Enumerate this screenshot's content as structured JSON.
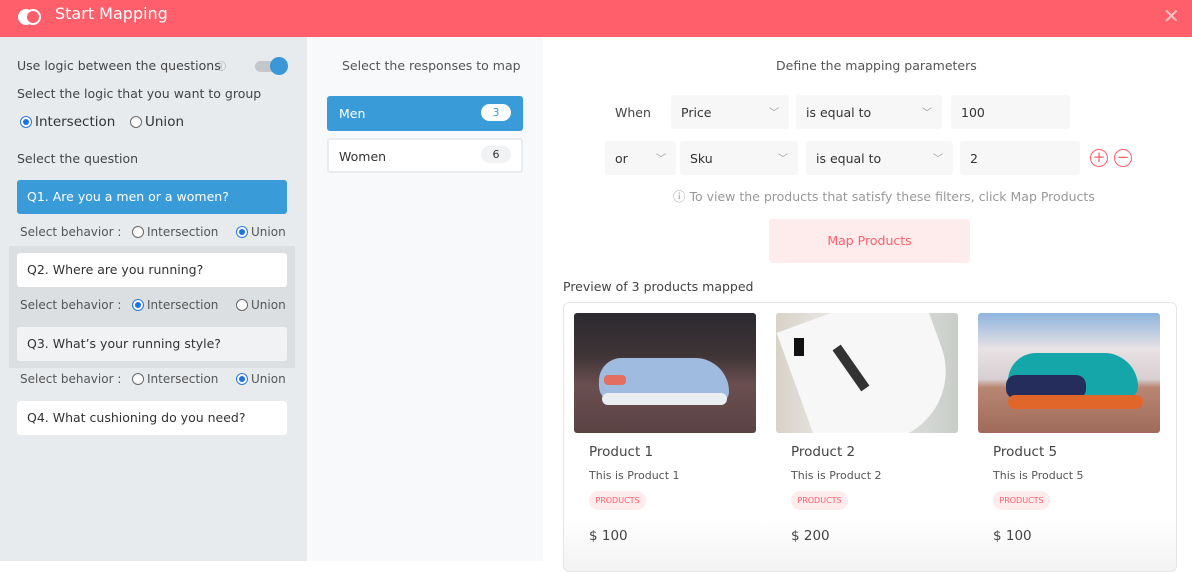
{
  "header": {
    "title": "Start Mapping",
    "logo_icon": "overlapping-circles-icon",
    "close_icon": "close-icon"
  },
  "left": {
    "use_logic_label": "Use logic between the questions",
    "info_icon": "info-icon",
    "toggle_on": true,
    "group_label": "Select the logic that you want to group",
    "group_options": [
      "Intersection",
      "Union"
    ],
    "group_selected": "Intersection",
    "select_question_label": "Select the question",
    "behavior_label": "Select behavior :",
    "behavior_options": [
      "Intersection",
      "Union"
    ],
    "questions": [
      {
        "label": "Q1.  Are you a men or a women?",
        "behavior": "Union"
      },
      {
        "label": "Q2.  Where are you running?",
        "behavior": "Intersection"
      },
      {
        "label": "Q3.  What’s your running style?",
        "behavior": "Union"
      },
      {
        "label": "Q4.  What cushioning do you need?"
      }
    ]
  },
  "middle": {
    "title": "Select the responses to map",
    "responses": [
      {
        "label": "Men",
        "count": "3"
      },
      {
        "label": "Women",
        "count": "6"
      }
    ]
  },
  "right": {
    "title": "Define the mapping parameters",
    "row1": {
      "prefix": "When",
      "field": "Price",
      "operator": "is equal to",
      "value": "100"
    },
    "row2": {
      "connector": "or",
      "field": "Sku",
      "operator": "is equal to",
      "value": "2"
    },
    "hint": "ⓘ To view the products that satisfy these filters, click Map Products",
    "map_button": "Map Products",
    "preview_title": "Preview of 3 products mapped",
    "products": [
      {
        "name": "Product 1",
        "desc": "This is Product 1",
        "tag": "PRODUCTS",
        "price": "$ 100"
      },
      {
        "name": "Product 2",
        "desc": "This is Product 2",
        "tag": "PRODUCTS",
        "price": "$ 200"
      },
      {
        "name": "Product 5",
        "desc": "This is Product 5",
        "tag": "PRODUCTS",
        "price": "$ 100"
      }
    ]
  }
}
